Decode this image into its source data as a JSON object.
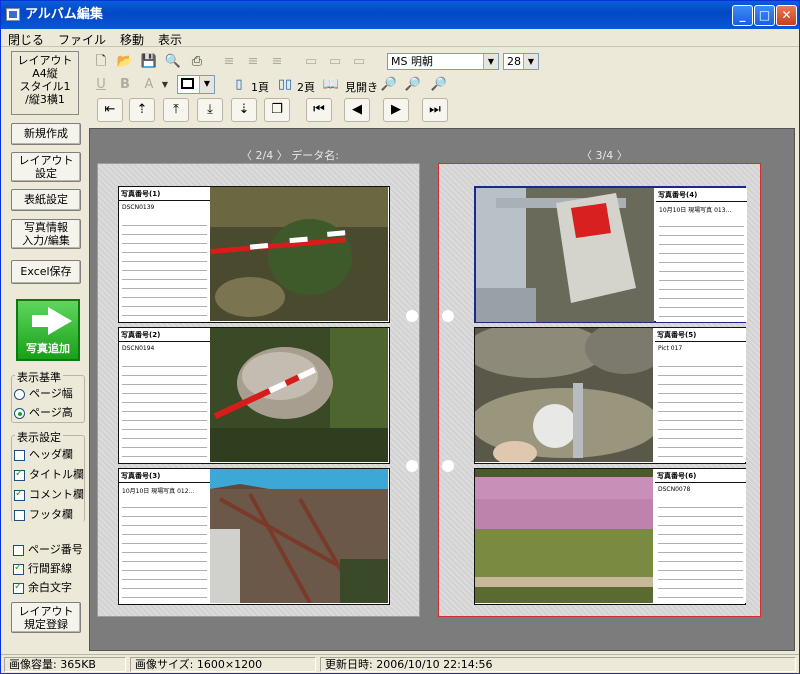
{
  "window": {
    "title": "アルバム編集",
    "minimize": "_",
    "maximize": "□",
    "close": "✕"
  },
  "menu": [
    "閉じる",
    "ファイル",
    "移動",
    "表示"
  ],
  "left": {
    "layout_box": [
      "レイアウト",
      "A4縦",
      "スタイル1",
      "/縦3横1"
    ],
    "buttons": {
      "new": "新規作成",
      "layout_settings": [
        "レイアウト",
        "設定"
      ],
      "cover": "表紙設定",
      "photo_info": [
        "写真情報",
        "入力/編集"
      ],
      "excel": "Excel保存",
      "register": [
        "レイアウト",
        "規定登録"
      ]
    },
    "photo_add": "写真追加",
    "display_basis": {
      "title": "表示基準",
      "options": [
        {
          "label": "ページ幅",
          "selected": false
        },
        {
          "label": "ページ高",
          "selected": true
        }
      ]
    },
    "display_settings": {
      "title": "表示設定",
      "options": [
        {
          "label": "ヘッダ欄",
          "checked": false
        },
        {
          "label": "タイトル欄",
          "checked": true
        },
        {
          "label": "コメント欄",
          "checked": true
        },
        {
          "label": "フッタ欄",
          "checked": false
        }
      ]
    },
    "extra": [
      {
        "label": "ページ番号",
        "checked": false
      },
      {
        "label": "行間罫線",
        "checked": true
      },
      {
        "label": "余白文字",
        "checked": true
      }
    ]
  },
  "toolbar": {
    "font": "MS 明朝",
    "size": "28",
    "one_page": "1頁",
    "two_page": "2頁",
    "spread": "見開き"
  },
  "pages": [
    {
      "title": "〈 2/4 〉 データ名:",
      "entries": [
        {
          "header": "写真番号(1)",
          "value": "DSCN0139"
        },
        {
          "header": "写真番号(2)",
          "value": "DSCN0194"
        },
        {
          "header": "写真番号(3)",
          "value": "10月10日 現場写真 012..."
        }
      ]
    },
    {
      "title": "〈 3/4 〉",
      "entries": [
        {
          "header": "写真番号(4)",
          "value": "10月10日 現場写真 013..."
        },
        {
          "header": "写真番号(5)",
          "value": "Pict 017"
        },
        {
          "header": "写真番号(6)",
          "value": "DSCN0078"
        }
      ]
    }
  ],
  "status": {
    "capacity": "画像容量: 365KB",
    "size": "画像サイズ: 1600×1200",
    "updated": "更新日時: 2006/10/10 22:14:56"
  }
}
